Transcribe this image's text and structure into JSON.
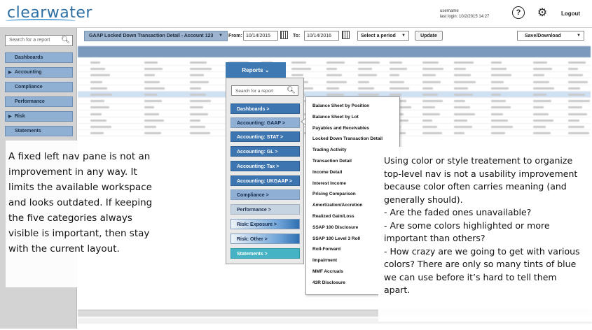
{
  "header": {
    "logo_text": "clearwater",
    "user_label": "username",
    "last_login": "last login: 10/2/2015 14:27",
    "help_icon": "help-icon",
    "settings_icon": "gear-icon",
    "logout_label": "Logout"
  },
  "left_nav": {
    "search_placeholder": "Search for a report",
    "items": [
      {
        "label": "Dashboards",
        "expandable": false
      },
      {
        "label": "Accounting",
        "expandable": true
      },
      {
        "label": "Compliance",
        "expandable": false
      },
      {
        "label": "Performance",
        "expandable": false
      },
      {
        "label": "Risk",
        "expandable": true
      },
      {
        "label": "Statements",
        "expandable": false
      }
    ]
  },
  "toolbar": {
    "report_name": "GAAP Locked Down Transaction Detail - Account 123",
    "from_label": "From:",
    "from_date": "10/14/2015",
    "to_label": "To:",
    "to_date": "10/14/2016",
    "period_label": "Select a period",
    "update_label": "Update",
    "save_label": "Save/Download"
  },
  "reports_menu": {
    "button_label": "Reports",
    "search_placeholder": "Search for a report",
    "items": [
      {
        "label": "Dashboards >",
        "style": "dark"
      },
      {
        "label": "Accounting: GAAP >",
        "style": "medium"
      },
      {
        "label": "Accounting: STAT >",
        "style": "dark"
      },
      {
        "label": "Accounting: GL >",
        "style": "dark"
      },
      {
        "label": "Accounting: Tax >",
        "style": "dark"
      },
      {
        "label": "Accounting: UKGAAP >",
        "style": "dark"
      },
      {
        "label": "Compliance >",
        "style": "medium"
      },
      {
        "label": "Performance >",
        "style": "light"
      },
      {
        "label": "Risk: Exposure >",
        "style": "gradient"
      },
      {
        "label": "Risk: Other >",
        "style": "gradient"
      },
      {
        "label": "Statements >",
        "style": "teal"
      }
    ],
    "submenu": [
      "Balance Sheet by Position",
      "Balance Sheet by Lot",
      "Payables and Receivables",
      "Locked Down Transaction Detail",
      "Trading Activity",
      "Transaction Detail",
      "Income Detail",
      "Interest Income",
      "Pricing Comparison",
      "Amortization/Accretion",
      "Realized Gain/Loss",
      "SSAP 100 Disclosure",
      "SSAP 100 Level 3 Roll",
      "Roll-Forward",
      "Impairment",
      "MMF Accruals",
      "43R Disclosure"
    ]
  },
  "annotations": {
    "left_note": "A fixed left nav pane is not an improvement in any way. It limits the available workspace and looks outdated. If keeping the five categories always visible is important, then stay with the current layout.",
    "right_note": [
      "Using color or style treatement to organize top-level nav is not a usability improvement because color often carries meaning (and generally should).",
      "- Are the faded ones unavailable?",
      "- Are some colors highlighted or more important than others?",
      "- How crazy are we going to get with various colors? There are only so many tints of blue we can use before it’s hard to tell them apart."
    ]
  },
  "colors": {
    "brand": "#2e6fa3",
    "nav_blue": "#8fb0d2",
    "menu_dark": "#3d75b0",
    "menu_teal": "#45b3c3"
  }
}
